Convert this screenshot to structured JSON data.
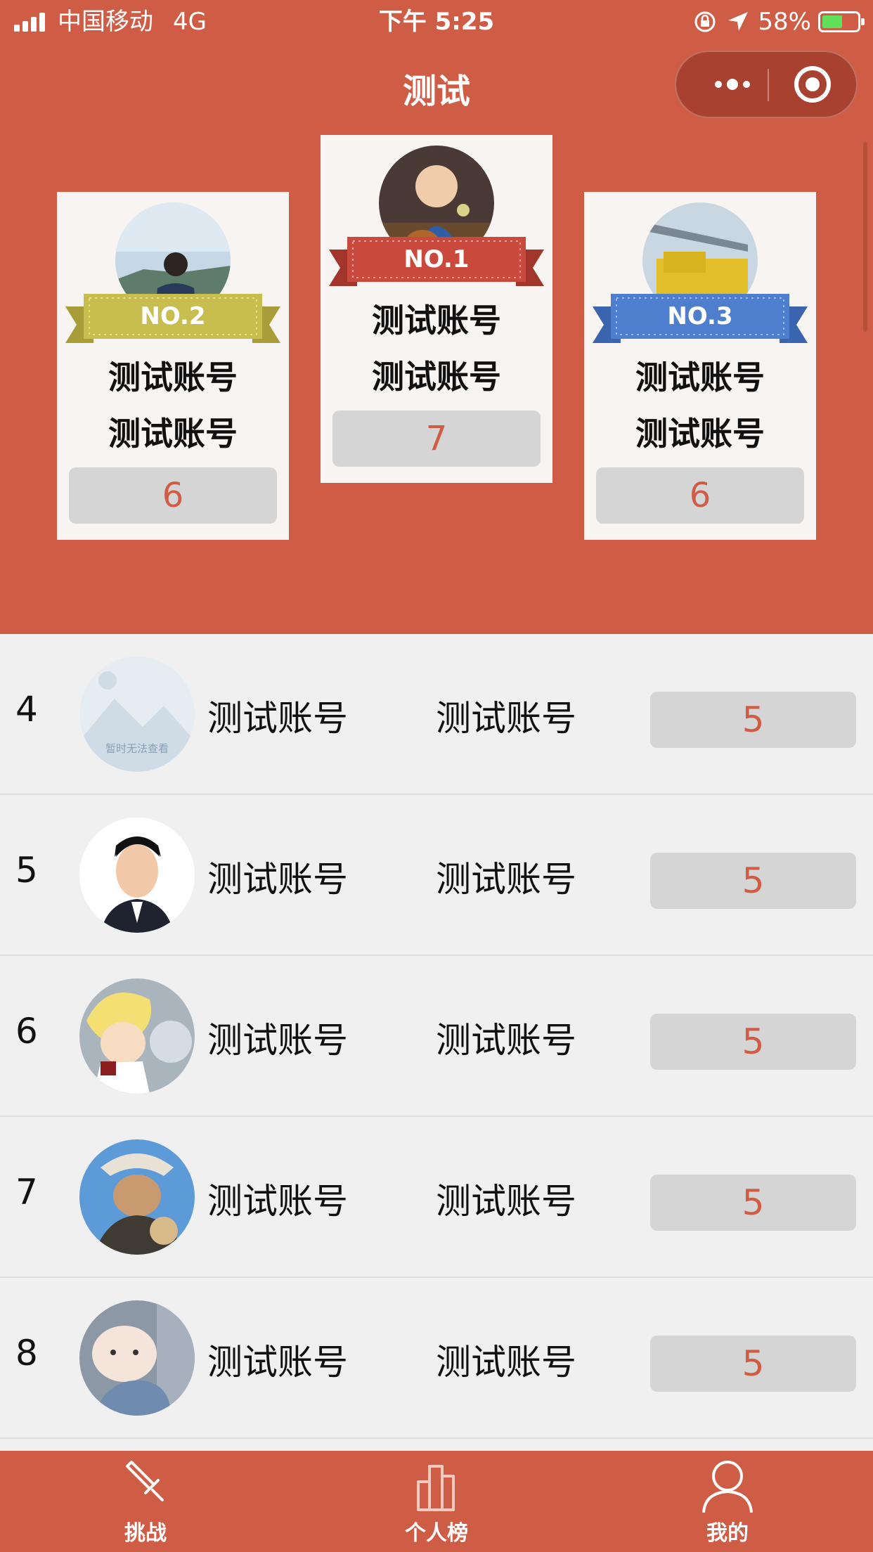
{
  "status_bar": {
    "carrier": "中国移动",
    "network": "4G",
    "time": "下午 5:25",
    "battery_percent": "58%",
    "battery_level": 0.58
  },
  "nav": {
    "title": "测试",
    "more_icon": "more-dots-icon",
    "close_icon": "target-circle-icon"
  },
  "podium": [
    {
      "badge": "NO.1",
      "name_line1": "测试账号",
      "name_line2": "测试账号",
      "score": "7",
      "ribbon_color": "#c94a3d"
    },
    {
      "badge": "NO.2",
      "name_line1": "测试账号",
      "name_line2": "测试账号",
      "score": "6",
      "ribbon_color": "#c8bd4f"
    },
    {
      "badge": "NO.3",
      "name_line1": "测试账号",
      "name_line2": "测试账号",
      "score": "6",
      "ribbon_color": "#4e7fce"
    }
  ],
  "list": [
    {
      "rank": "4",
      "name1": "测试账号",
      "name2": "测试账号",
      "score": "5",
      "avatar_note": "暂时无法查看"
    },
    {
      "rank": "5",
      "name1": "测试账号",
      "name2": "测试账号",
      "score": "5"
    },
    {
      "rank": "6",
      "name1": "测试账号",
      "name2": "测试账号",
      "score": "5"
    },
    {
      "rank": "7",
      "name1": "测试账号",
      "name2": "测试账号",
      "score": "5"
    },
    {
      "rank": "8",
      "name1": "测试账号",
      "name2": "测试账号",
      "score": "5"
    }
  ],
  "tabbar": {
    "items": [
      {
        "label": "挑战",
        "icon": "sword-icon"
      },
      {
        "label": "个人榜",
        "icon": "bar-chart-icon"
      },
      {
        "label": "我的",
        "icon": "user-icon"
      }
    ]
  },
  "colors": {
    "primary": "#cf5c44",
    "score_text": "#cf5c44",
    "score_bg": "#d5d5d5",
    "list_bg": "#f0f0f0"
  }
}
